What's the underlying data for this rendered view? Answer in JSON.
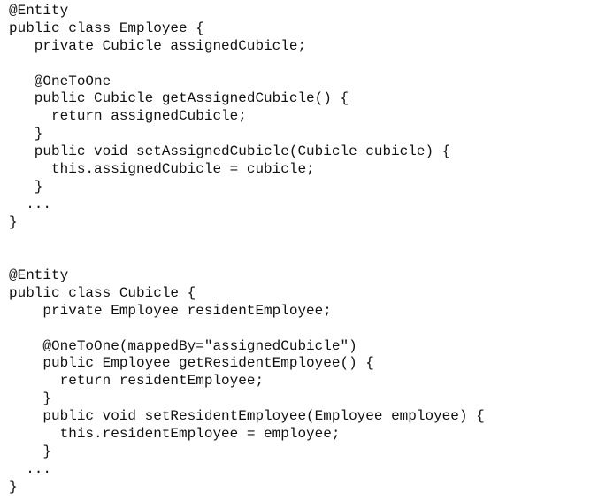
{
  "code_blocks": [
    {
      "lines": [
        "@Entity",
        "public class Employee {",
        "   private Cubicle assignedCubicle;",
        "",
        "   @OneToOne",
        "   public Cubicle getAssignedCubicle() {",
        "     return assignedCubicle;",
        "   }",
        "   public void setAssignedCubicle(Cubicle cubicle) {",
        "     this.assignedCubicle = cubicle;",
        "   }",
        "  ...",
        "}"
      ]
    },
    {
      "lines": [
        "@Entity",
        "public class Cubicle {",
        "    private Employee residentEmployee;",
        "",
        "    @OneToOne(mappedBy=\"assignedCubicle\")",
        "    public Employee getResidentEmployee() {",
        "      return residentEmployee;",
        "    }",
        "    public void setResidentEmployee(Employee employee) {",
        "      this.residentEmployee = employee;",
        "    }",
        "  ...",
        "}"
      ]
    }
  ]
}
